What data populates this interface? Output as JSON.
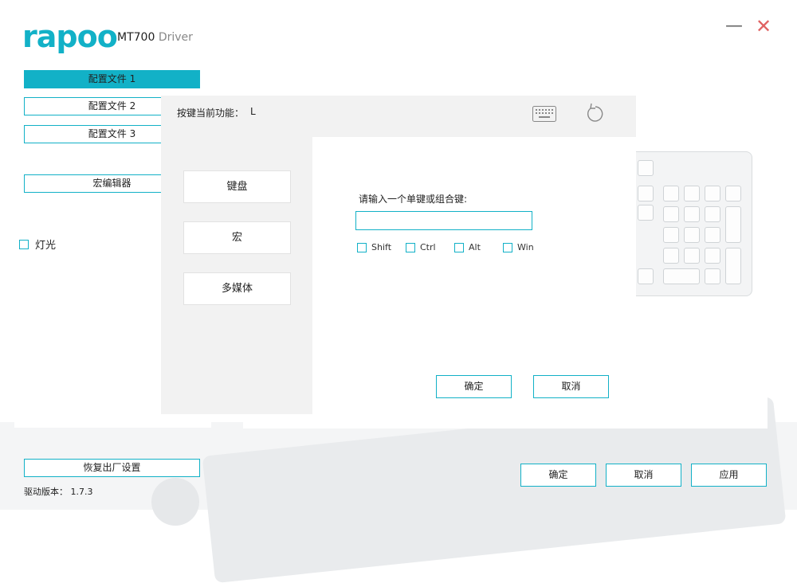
{
  "header": {
    "logo_text": "rapoo",
    "model": "MT700",
    "driver_label": "Driver",
    "minimize_glyph": "—",
    "close_glyph": "✕"
  },
  "sidebar": {
    "profiles": [
      {
        "label": "配置文件 1",
        "active": true
      },
      {
        "label": "配置文件 2",
        "active": false
      },
      {
        "label": "配置文件 3",
        "active": false
      }
    ],
    "macro_editor": "宏编辑器",
    "lighting_label": "灯光"
  },
  "dialog": {
    "current_function_label": "按键当前功能：",
    "current_key": "L",
    "types": [
      "键盘",
      "宏",
      "多媒体"
    ],
    "prompt": "请输入一个单键或组合键:",
    "key_input_value": "",
    "modifiers": [
      "Shift",
      "Ctrl",
      "Alt",
      "Win"
    ],
    "ok": "确定",
    "cancel": "取消"
  },
  "footer": {
    "factory_reset": "恢复出厂设置",
    "version_label": "驱动版本：",
    "version": "1.7.3",
    "ok": "确定",
    "cancel": "取消",
    "apply": "应用"
  },
  "colors": {
    "accent": "#12b1c7",
    "close": "#e06262",
    "panel_gray": "#f2f2f2"
  },
  "icons": {
    "keyboard": "keyboard-icon",
    "reset": "rotate-ccw-icon"
  }
}
